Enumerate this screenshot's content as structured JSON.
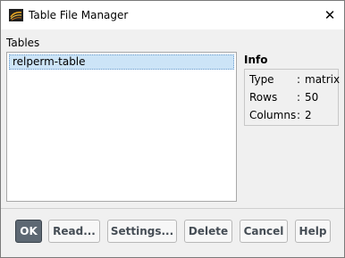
{
  "window": {
    "title": "Table File Manager",
    "close_glyph": "✕"
  },
  "tables": {
    "label": "Tables",
    "items": [
      {
        "name": "relperm-table",
        "selected": true
      }
    ]
  },
  "info": {
    "label": "Info",
    "rows": [
      {
        "key": "Type",
        "sep": ":",
        "value": "matrix"
      },
      {
        "key": "Rows",
        "sep": ":",
        "value": "50"
      },
      {
        "key": "Columns",
        "sep": ":",
        "value": "2"
      }
    ]
  },
  "buttons": {
    "ok": "OK",
    "read": "Read...",
    "settings": "Settings...",
    "delete": "Delete",
    "cancel": "Cancel",
    "help": "Help"
  },
  "colors": {
    "selection": "#cce4f7",
    "primary_button": "#5d6873",
    "button_text": "#454d55"
  },
  "icons": {
    "app": "fluent-app-icon",
    "close": "close-icon"
  }
}
